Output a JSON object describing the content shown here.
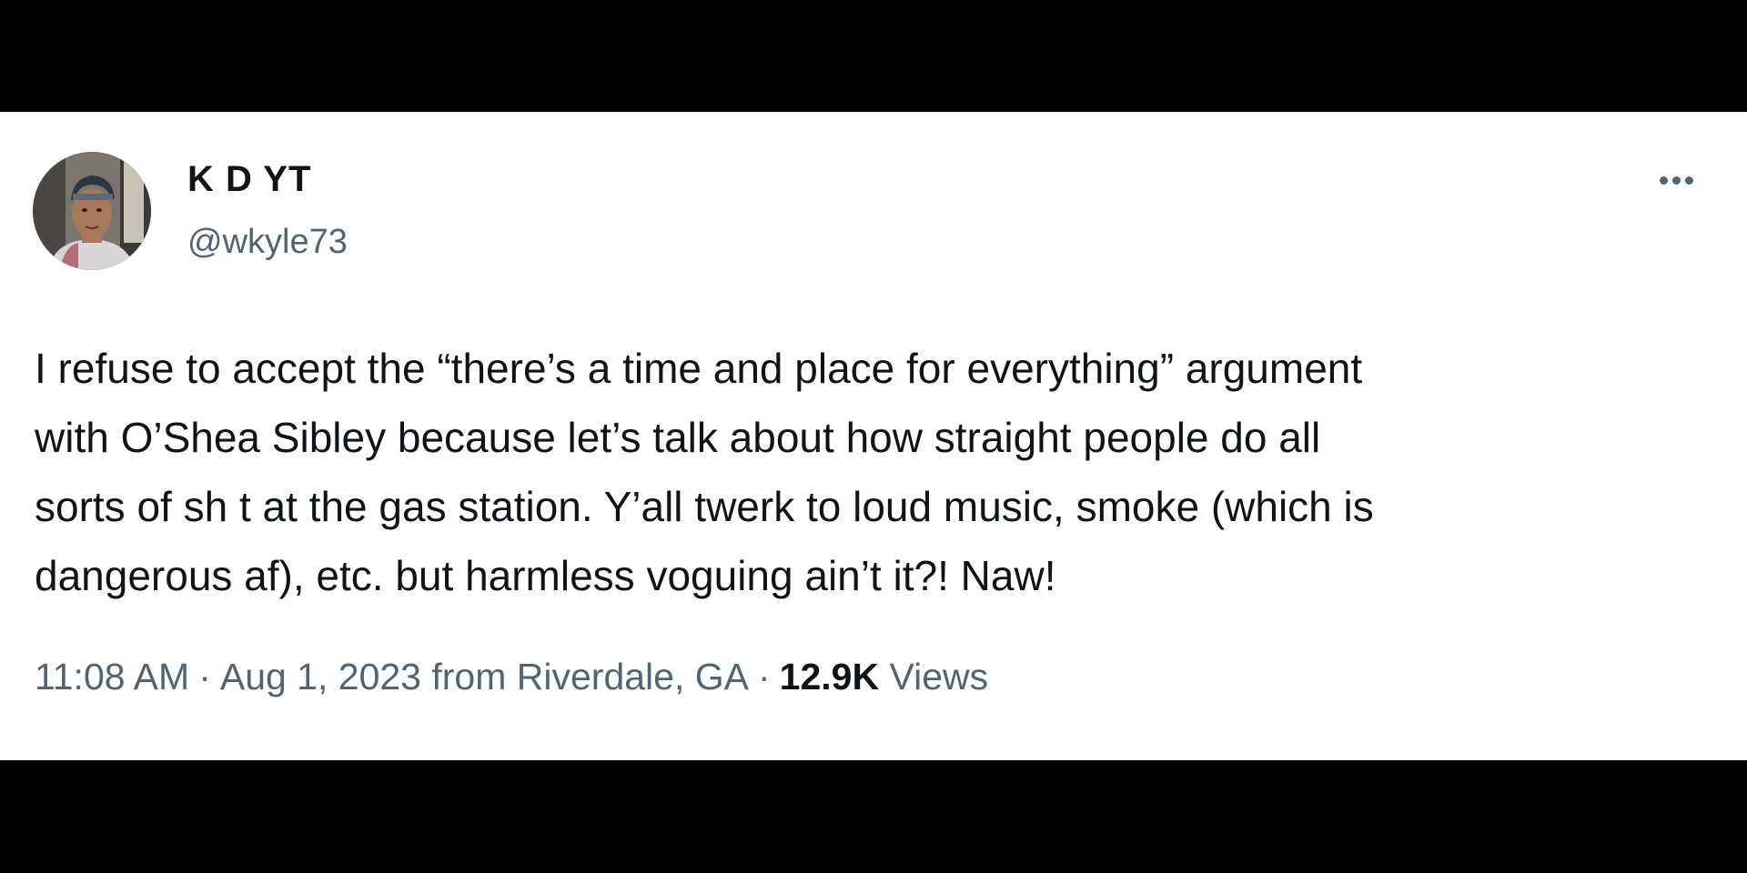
{
  "tweet": {
    "author": {
      "display_name": "K D YT",
      "handle": "@wkyle73",
      "avatar_icon": "profile-photo"
    },
    "more_icon": "more-horizontal-icon",
    "text_lines": [
      "I refuse to accept the “there’s a time and place for everything” argument",
      "with O’Shea Sibley because let’s talk about how straight people do all",
      "sorts of sh t at the gas station. Y’all twerk to loud music, smoke (which is",
      "dangerous af), etc. but harmless voguing ain’t it?!  Naw!"
    ],
    "meta": {
      "time": "11:08 AM",
      "separator": "·",
      "date": "Aug 1, 2023",
      "source": "from Riverdale, GA",
      "views_count": "12.9K",
      "views_label": "Views"
    }
  },
  "colors": {
    "text_primary": "#0f1419",
    "text_secondary": "#536471",
    "background": "#ffffff",
    "letterbox": "#000000"
  }
}
